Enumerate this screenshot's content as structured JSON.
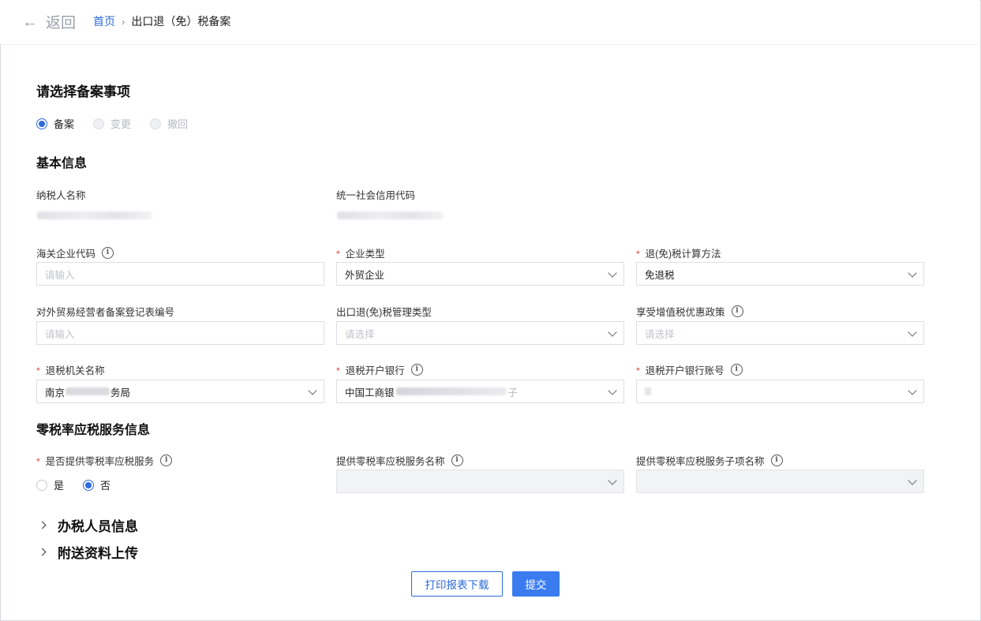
{
  "header": {
    "back_label": "返回",
    "breadcrumb_home": "首页",
    "breadcrumb_current": "出口退（免）税备案"
  },
  "filing": {
    "title": "请选择备案事项",
    "options": [
      {
        "label": "备案",
        "selected": true,
        "disabled": false
      },
      {
        "label": "变更",
        "selected": false,
        "disabled": true
      },
      {
        "label": "撤回",
        "selected": false,
        "disabled": true
      }
    ]
  },
  "basic": {
    "title": "基本信息",
    "taxpayer_name_label": "纳税人名称",
    "credit_code_label": "统一社会信用代码",
    "customs_code_label": "海关企业代码",
    "customs_code_placeholder": "请输入",
    "enterprise_type_label": "企业类型",
    "enterprise_type_value": "外贸企业",
    "calc_method_label": "退(免)税计算方法",
    "calc_method_value": "免退税",
    "trade_reg_label": "对外贸易经营者备案登记表编号",
    "trade_reg_placeholder": "请输入",
    "mgmt_type_label": "出口退(免)税管理类型",
    "mgmt_type_placeholder": "请选择",
    "vat_policy_label": "享受增值税优惠政策",
    "vat_policy_placeholder": "请选择",
    "refund_office_label": "退税机关名称",
    "refund_office_value_start": "南京",
    "refund_office_value_end": "务局",
    "bank_label": "退税开户银行",
    "bank_value_start": "中国工商银",
    "bank_value_end": "子",
    "bank_account_label": "退税开户银行账号"
  },
  "zero_rate": {
    "title": "零税率应税服务信息",
    "provide_label": "是否提供零税率应税服务",
    "options": [
      {
        "label": "是",
        "selected": false
      },
      {
        "label": "否",
        "selected": true
      }
    ],
    "service_name_label": "提供零税率应税服务名称",
    "service_sub_label": "提供零税率应税服务子项名称"
  },
  "sections": {
    "staff": "办税人员信息",
    "attachments": "附送资料上传"
  },
  "actions": {
    "print_label": "打印报表下载",
    "submit_label": "提交"
  },
  "colors": {
    "primary": "#3a7cf0",
    "link": "#2d6bdc",
    "required": "#e0443a"
  }
}
